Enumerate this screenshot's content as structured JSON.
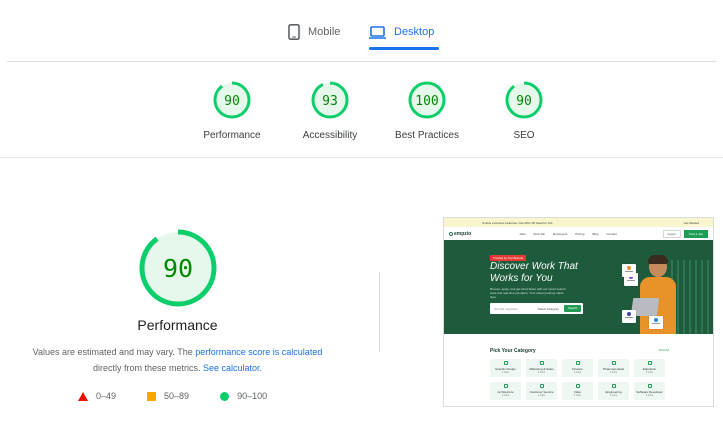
{
  "tabs": [
    {
      "label": "Mobile",
      "icon": "phone-icon",
      "active": false
    },
    {
      "label": "Desktop",
      "icon": "laptop-icon",
      "active": true
    }
  ],
  "summary": [
    {
      "score": "90",
      "label": "Performance"
    },
    {
      "score": "93",
      "label": "Accessibility"
    },
    {
      "score": "100",
      "label": "Best Practices"
    },
    {
      "score": "90",
      "label": "SEO"
    }
  ],
  "colors": {
    "pass": "#0cce6b",
    "pass_text": "#008800",
    "pass_bg": "#e6f8ec",
    "average": "#ffa400",
    "fail": "#eb0f00",
    "link": "#1a73e8"
  },
  "performance": {
    "score": "90",
    "title": "Performance",
    "desc_prefix": "Values are estimated and may vary. The ",
    "desc_link1": "performance score is calculated",
    "desc_mid": " directly from these metrics. ",
    "desc_link2": "See calculator."
  },
  "legend": [
    {
      "shape": "triangle",
      "range": "0–49"
    },
    {
      "shape": "square",
      "range": "50–89"
    },
    {
      "shape": "circle",
      "range": "90–100"
    }
  ],
  "thumbnail": {
    "announcement": "Unlock exclusive Features: Get 20% Off Ideal for Job",
    "announcement_right": "Get Started",
    "logo": "empzio",
    "menu": [
      "Jobs",
      "Find Job",
      "Employers",
      "Pricing",
      "Blog",
      "Contact"
    ],
    "btn_login": "Log in",
    "btn_post": "Post a Job",
    "badge": "Trusted by Top Brands",
    "headline": "Discover Work That Works for You",
    "subtext": "Browse, apply, and get hired faster with our smart search tools and real-time job alerts. Your career journey starts here.",
    "search_placeholder": "Job title, keyword...",
    "search_select": "Select Category",
    "search_button": "Search",
    "categories_title": "Pick Your Category",
    "categories_link": "View All",
    "categories": [
      {
        "name": "Graphic Design",
        "count": "2 Jobs"
      },
      {
        "name": "Marketing & Sales",
        "count": "4 Jobs"
      },
      {
        "name": "Finance",
        "count": "3 Jobs"
      },
      {
        "name": "Pharmaceutical",
        "count": "2 Jobs"
      },
      {
        "name": "Education",
        "count": "5 Jobs"
      },
      {
        "name": "Architecture",
        "count": "3 Jobs"
      },
      {
        "name": "Customer Service",
        "count": "2 Jobs"
      },
      {
        "name": "Data",
        "count": "4 Jobs"
      },
      {
        "name": "Engineering",
        "count": "3 Jobs"
      },
      {
        "name": "Software Developer",
        "count": "6 Jobs"
      }
    ]
  }
}
